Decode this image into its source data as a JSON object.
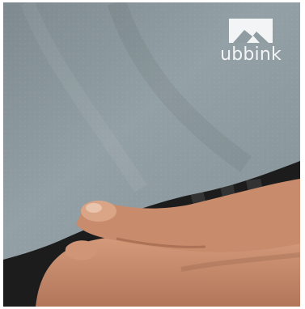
{
  "photo": {
    "subject": "fingers-pressing-membrane-edge",
    "colors": {
      "membrane": "#8b979c",
      "membrane_shadow": "#6f7a7f",
      "dark_gutter": "#1c1c1c",
      "skin": "#c78b6c",
      "skin_shadow": "#a76a4f"
    }
  },
  "logo": {
    "brand": "ubbink",
    "icon": "house-roof-icon",
    "color": "#f2f4f5"
  }
}
